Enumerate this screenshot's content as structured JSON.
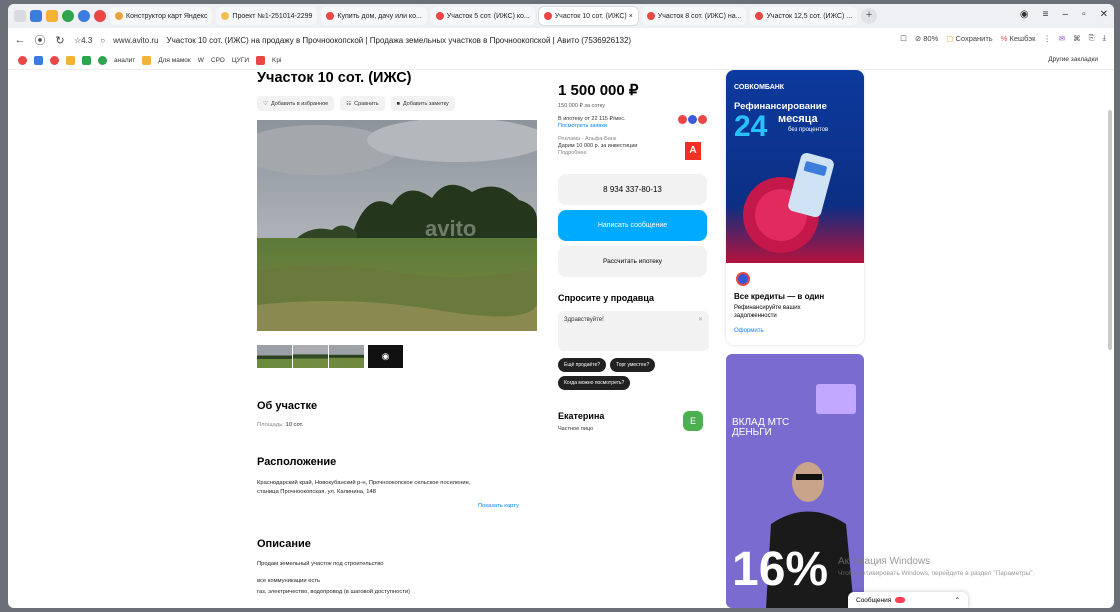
{
  "browser": {
    "tabs": [
      {
        "label": "Конструктор карт Яндекс",
        "color": "#e8a33b",
        "active": false
      },
      {
        "label": "Проект №1-251014-2299",
        "color": "#f0c050",
        "active": false
      },
      {
        "label": "Купить дом, дачу или ко...",
        "color": "#e94646",
        "active": false
      },
      {
        "label": "Участок 5 сот. (ИЖС) ко...",
        "color": "#e94646",
        "active": false
      },
      {
        "label": "Участок 10 сот. (ИЖС) ×",
        "color": "#e94646",
        "active": true
      },
      {
        "label": "Участок 8 сот. (ИЖС) на...",
        "color": "#e94646",
        "active": false
      },
      {
        "label": "Участок 12,5 сот. (ИЖС) ...",
        "color": "#e94646",
        "active": false
      }
    ],
    "rating": "4.3",
    "url": "www.avito.ru",
    "page_title": "Участок 10 сот. (ИЖС) на продажу в Прочноокопской | Продажа земельных участков в Прочноокопской | Авито (7536926132)",
    "zoom": "80%",
    "save_label": "Сохранить",
    "cashback_label": "Кешбэк",
    "bookmarks": [
      "аналит",
      "Для мамок",
      "W",
      "СРО",
      "ЦУГИ",
      "Kpi"
    ],
    "other_bookmarks": "Другие закладки"
  },
  "listing": {
    "title": "Участок 10 сот. (ИЖС)",
    "actions": [
      "Добавить в избранное",
      "Сравнить",
      "Добавить заметку"
    ],
    "watermark": "avito",
    "about_h": "Об участке",
    "area_label": "Площадь:",
    "area_value": "10 сот.",
    "location_h": "Расположение",
    "address": "Краснодарский край, Новокубанский р-н, Прочноокопское сельское поселение, станица Прочноокопская, ул. Калинина, 148",
    "show_map": "Показать карту",
    "desc_h": "Описание",
    "desc_1": "Продам земельный участок под строительство",
    "desc_2": "все коммуникации есть",
    "desc_3": "газ, электричество, водопровод (в шаговой доступности)"
  },
  "sidebar": {
    "price": "1 500 000 ₽",
    "per": "150 000 ₽ за сотку",
    "mortgage": "В ипотеку от 22 115 ₽/мес.",
    "mortgage_link": "Посмотреть заявки",
    "bank_label": "Реклама · Альфа-Банк",
    "bank_text": "Дарим 10 000 р. за инвестиции",
    "bank_more": "Подробнее",
    "phone": "8 934 337-80-13",
    "write": "Написать сообщение",
    "calc": "Рассчитать ипотеку",
    "ask_h": "Спросите у продавца",
    "ask_placeholder": "Здравствуйте!",
    "chips": [
      "Ещё продаёте?",
      "Торг уместен?",
      "Когда можно посмотреть?"
    ],
    "seller": "Екатерина",
    "seller_type": "Частное лицо",
    "seller_initial": "E"
  },
  "ads": {
    "bank": "СОВКОМБАНК",
    "refi": "Рефинансирование",
    "big": "24",
    "months": "месяца",
    "no_interest": "без процентов",
    "all_credits": "Все кредиты — в один",
    "refi_text": "Рефинансируйте ваших задолженности",
    "apply": "Оформить",
    "mts": "ВКЛАД МТС ДЕНЬГИ",
    "percent": "16%"
  },
  "os": {
    "activate": "Активация Windows",
    "activate_sub": "Чтобы активировать Windows, перейдите в раздел \"Параметры\".",
    "messages": "Сообщения"
  }
}
